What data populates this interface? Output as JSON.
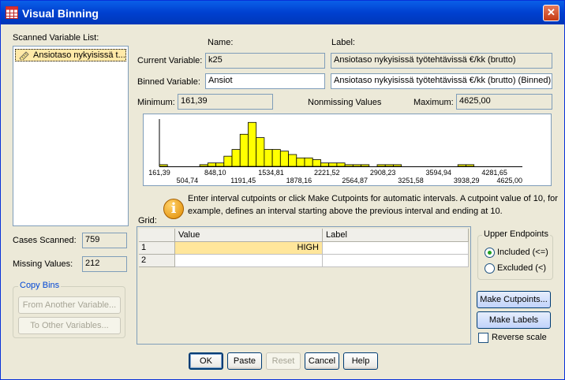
{
  "window": {
    "title": "Visual Binning",
    "close_glyph": "✕"
  },
  "scanned": {
    "label": "Scanned Variable List:",
    "items": [
      {
        "label": "Ansiotaso nykyisissä t...",
        "icon": "scale-ruler-icon"
      }
    ]
  },
  "labels": {
    "name": "Name:",
    "label": "Label:",
    "current": "Current Variable:",
    "binned": "Binned Variable:",
    "minimum": "Minimum:",
    "nonmissing": "Nonmissing Values",
    "maximum": "Maximum:"
  },
  "current": {
    "name": "k25",
    "label": "Ansiotaso nykyisissä työtehtävissä €/kk (brutto)"
  },
  "binned": {
    "name": "Ansiot",
    "label": "Ansiotaso nykyisissä työtehtävissä €/kk (brutto) (Binned)"
  },
  "stats": {
    "minimum": "161,39",
    "maximum": "4625,00",
    "cases_label": "Cases Scanned:",
    "cases": "759",
    "missing_label": "Missing Values:",
    "missing": "212"
  },
  "chart_data": {
    "type": "bar",
    "title": "",
    "xlabel": "",
    "ylabel": "",
    "bar_color": "#FFFF00",
    "xlim": [
      161.39,
      4625.0
    ],
    "ticks_top": [
      "161,39",
      "848,10",
      "1534,81",
      "2221,52",
      "2908,23",
      "3594,94",
      "4281,65"
    ],
    "ticks_bottom": [
      "504,74",
      "1191,45",
      "1878,16",
      "2564,87",
      "3251,58",
      "3938,29",
      "4625,00"
    ],
    "values": [
      1,
      0,
      0,
      0,
      0,
      1,
      2,
      2,
      6,
      10,
      19,
      26,
      17,
      10,
      10,
      9,
      7,
      5,
      5,
      4,
      2,
      2,
      2,
      1,
      1,
      1,
      0,
      1,
      1,
      1,
      0,
      0,
      0,
      0,
      0,
      0,
      0,
      1,
      1,
      0,
      0,
      0,
      0,
      0,
      0
    ],
    "ylim": [
      0,
      28
    ]
  },
  "info": {
    "text": "Enter interval cutpoints or click Make Cutpoints for automatic intervals. A cutpoint value of 10, for example, defines an interval starting above the previous interval and ending at 10."
  },
  "grid": {
    "label": "Grid:",
    "headers": [
      "Value",
      "Label"
    ],
    "rows": [
      {
        "num": "1",
        "value": "HIGH",
        "label": ""
      },
      {
        "num": "2",
        "value": "",
        "label": ""
      }
    ]
  },
  "copy_bins": {
    "title": "Copy Bins",
    "from": "From Another Variable...",
    "to": "To Other Variables..."
  },
  "upper": {
    "title": "Upper Endpoints",
    "included": "Included (<=)",
    "excluded": "Excluded (<)"
  },
  "buttons": {
    "make_cutpoints": "Make Cutpoints...",
    "make_labels": "Make Labels",
    "reverse": "Reverse scale",
    "ok": "OK",
    "paste": "Paste",
    "reset": "Reset",
    "cancel": "Cancel",
    "help": "Help"
  }
}
